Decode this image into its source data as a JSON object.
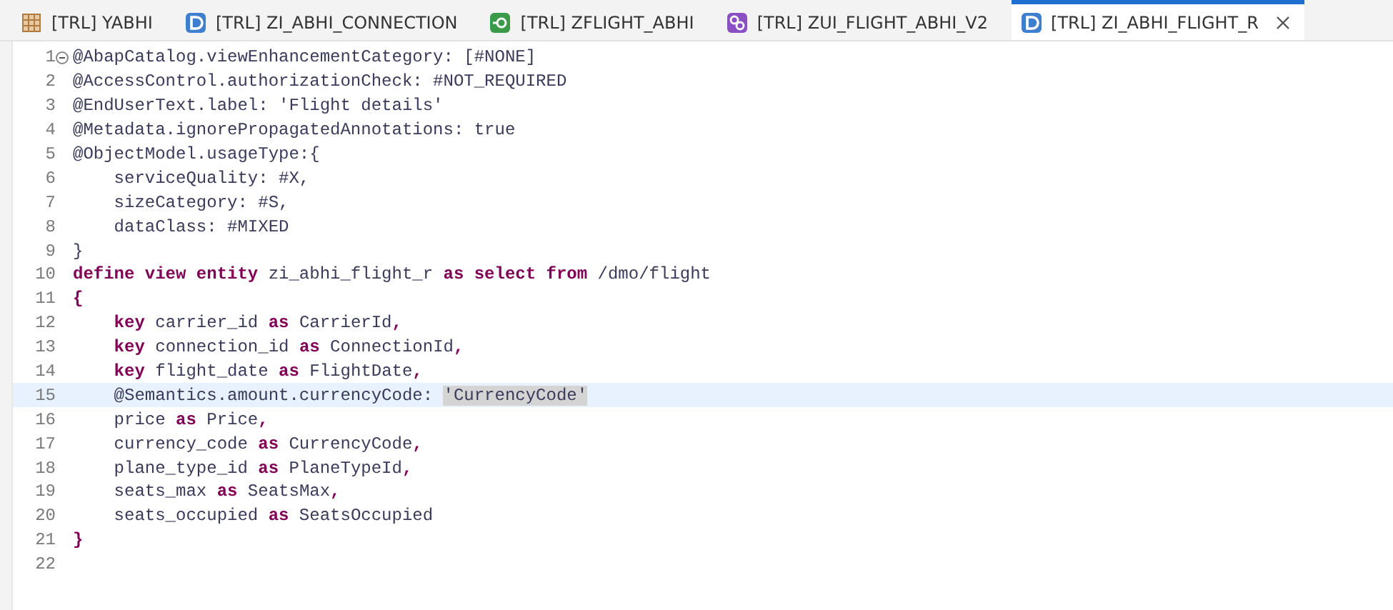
{
  "tabs": [
    {
      "label": "[TRL] YABHI",
      "kind": "table",
      "selected": false
    },
    {
      "label": "[TRL] ZI_ABHI_CONNECTION",
      "kind": "definition",
      "selected": false
    },
    {
      "label": "[TRL] ZFLIGHT_ABHI",
      "kind": "service",
      "selected": false
    },
    {
      "label": "[TRL] ZUI_FLIGHT_ABHI_V2",
      "kind": "binding",
      "selected": false
    },
    {
      "label": "[TRL] ZI_ABHI_FLIGHT_R",
      "kind": "definition",
      "selected": true
    }
  ],
  "editor": {
    "lines": [
      {
        "number": "1",
        "collapsible": true,
        "current": false,
        "tokens": [
          {
            "text": "@AbapCatalog.viewEnhancementCategory: [#NONE]",
            "kind": "plain"
          }
        ]
      },
      {
        "number": "2",
        "collapsible": false,
        "current": false,
        "tokens": [
          {
            "text": "@AccessControl.authorizationCheck: #NOT_REQUIRED",
            "kind": "plain"
          }
        ]
      },
      {
        "number": "3",
        "collapsible": false,
        "current": false,
        "tokens": [
          {
            "text": "@EndUserText.label: 'Flight details'",
            "kind": "plain"
          }
        ]
      },
      {
        "number": "4",
        "collapsible": false,
        "current": false,
        "tokens": [
          {
            "text": "@Metadata.ignorePropagatedAnnotations: true",
            "kind": "plain"
          }
        ]
      },
      {
        "number": "5",
        "collapsible": false,
        "current": false,
        "tokens": [
          {
            "text": "@ObjectModel.usageType:{",
            "kind": "plain"
          }
        ]
      },
      {
        "number": "6",
        "collapsible": false,
        "current": false,
        "tokens": [
          {
            "text": "    serviceQuality: #X,",
            "kind": "plain"
          }
        ]
      },
      {
        "number": "7",
        "collapsible": false,
        "current": false,
        "tokens": [
          {
            "text": "    sizeCategory: #S,",
            "kind": "plain"
          }
        ]
      },
      {
        "number": "8",
        "collapsible": false,
        "current": false,
        "tokens": [
          {
            "text": "    dataClass: #MIXED",
            "kind": "plain"
          }
        ]
      },
      {
        "number": "9",
        "collapsible": false,
        "current": false,
        "tokens": [
          {
            "text": "}",
            "kind": "plain"
          }
        ]
      },
      {
        "number": "10",
        "collapsible": false,
        "current": false,
        "tokens": [
          {
            "text": "define view entity",
            "kind": "keyword"
          },
          {
            "text": " zi_abhi_flight_r ",
            "kind": "plain"
          },
          {
            "text": "as select from",
            "kind": "keyword"
          },
          {
            "text": " /dmo/flight",
            "kind": "plain"
          }
        ]
      },
      {
        "number": "11",
        "collapsible": false,
        "current": false,
        "tokens": [
          {
            "text": "{",
            "kind": "keyword"
          }
        ]
      },
      {
        "number": "12",
        "collapsible": false,
        "current": false,
        "tokens": [
          {
            "text": "    key",
            "kind": "keyword"
          },
          {
            "text": " carrier_id ",
            "kind": "plain"
          },
          {
            "text": "as",
            "kind": "keyword"
          },
          {
            "text": " CarrierId",
            "kind": "plain"
          },
          {
            "text": ",",
            "kind": "keyword"
          }
        ]
      },
      {
        "number": "13",
        "collapsible": false,
        "current": false,
        "tokens": [
          {
            "text": "    key",
            "kind": "keyword"
          },
          {
            "text": " connection_id ",
            "kind": "plain"
          },
          {
            "text": "as",
            "kind": "keyword"
          },
          {
            "text": " ConnectionId",
            "kind": "plain"
          },
          {
            "text": ",",
            "kind": "keyword"
          }
        ]
      },
      {
        "number": "14",
        "collapsible": false,
        "current": false,
        "tokens": [
          {
            "text": "    key",
            "kind": "keyword"
          },
          {
            "text": " flight_date ",
            "kind": "plain"
          },
          {
            "text": "as",
            "kind": "keyword"
          },
          {
            "text": " FlightDate",
            "kind": "plain"
          },
          {
            "text": ",",
            "kind": "keyword"
          }
        ]
      },
      {
        "number": "15",
        "collapsible": false,
        "current": true,
        "tokens": [
          {
            "text": "    @Semantics.amount.currencyCode: ",
            "kind": "plain"
          },
          {
            "text": "'CurrencyCode'",
            "kind": "selection"
          }
        ]
      },
      {
        "number": "16",
        "collapsible": false,
        "current": false,
        "tokens": [
          {
            "text": "    price ",
            "kind": "plain"
          },
          {
            "text": "as",
            "kind": "keyword"
          },
          {
            "text": " Price",
            "kind": "plain"
          },
          {
            "text": ",",
            "kind": "keyword"
          }
        ]
      },
      {
        "number": "17",
        "collapsible": false,
        "current": false,
        "tokens": [
          {
            "text": "    currency_code ",
            "kind": "plain"
          },
          {
            "text": "as",
            "kind": "keyword"
          },
          {
            "text": " CurrencyCode",
            "kind": "plain"
          },
          {
            "text": ",",
            "kind": "keyword"
          }
        ]
      },
      {
        "number": "18",
        "collapsible": false,
        "current": false,
        "tokens": [
          {
            "text": "    plane_type_id ",
            "kind": "plain"
          },
          {
            "text": "as",
            "kind": "keyword"
          },
          {
            "text": " PlaneTypeId",
            "kind": "plain"
          },
          {
            "text": ",",
            "kind": "keyword"
          }
        ]
      },
      {
        "number": "19",
        "collapsible": false,
        "current": false,
        "tokens": [
          {
            "text": "    seats_max ",
            "kind": "plain"
          },
          {
            "text": "as",
            "kind": "keyword"
          },
          {
            "text": " SeatsMax",
            "kind": "plain"
          },
          {
            "text": ",",
            "kind": "keyword"
          }
        ]
      },
      {
        "number": "20",
        "collapsible": false,
        "current": false,
        "tokens": [
          {
            "text": "    seats_occupied ",
            "kind": "plain"
          },
          {
            "text": "as",
            "kind": "keyword"
          },
          {
            "text": " SeatsOccupied",
            "kind": "plain"
          }
        ]
      },
      {
        "number": "21",
        "collapsible": false,
        "current": false,
        "tokens": [
          {
            "text": "}",
            "kind": "keyword"
          }
        ]
      },
      {
        "number": "22",
        "collapsible": false,
        "current": false
      }
    ]
  }
}
